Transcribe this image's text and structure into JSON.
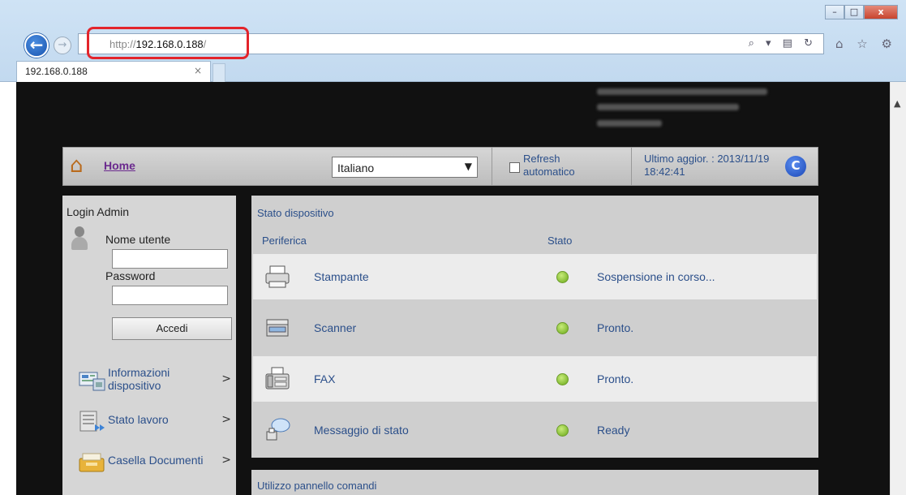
{
  "browser": {
    "url_prefix": "http://",
    "url_host": "192.168.0.188",
    "url_suffix": "/",
    "tab_title": "192.168.0.188",
    "tab_close": "×",
    "back_icon": "arrow-left",
    "forward_icon": "arrow-right",
    "window_controls": [
      "–",
      "□",
      "x"
    ],
    "address_icons": "⌕ ▾ ▤ ↻",
    "toolbar_icons": "⌂ ☆ ⚙"
  },
  "topbar": {
    "home_label": "Home",
    "language_value": "Italiano",
    "refresh_label": "Refresh automatico",
    "updated_label": "Ultimo aggior. : 2013/11/19 18:42:41",
    "refresh_button_icon": "C"
  },
  "login": {
    "title": "Login Admin",
    "username_label": "Nome utente",
    "username_value": "",
    "password_label": "Password",
    "password_value": "",
    "submit_label": "Accedi"
  },
  "sidebar": {
    "items": [
      {
        "label": "Informazioni dispositivo",
        "icon": "device-info"
      },
      {
        "label": "Stato lavoro",
        "icon": "job-status"
      },
      {
        "label": "Casella Documenti",
        "icon": "document-box"
      }
    ]
  },
  "device_status": {
    "title": "Stato dispositivo",
    "col_device": "Periferica",
    "col_status": "Stato",
    "rows": [
      {
        "name": "Stampante",
        "status": "Sospensione in corso...",
        "icon": "printer"
      },
      {
        "name": "Scanner",
        "status": "Pronto.",
        "icon": "scanner"
      },
      {
        "name": "FAX",
        "status": "Pronto.",
        "icon": "fax"
      },
      {
        "name": "Messaggio di stato",
        "status": "Ready",
        "icon": "status-message"
      }
    ]
  },
  "panel2": {
    "title": "Utilizzo pannello comandi"
  },
  "colors": {
    "link": "#2b4f8a",
    "home_link": "#6b2a8e",
    "status_ok": "#7dc320",
    "highlight": "#e3242b"
  }
}
